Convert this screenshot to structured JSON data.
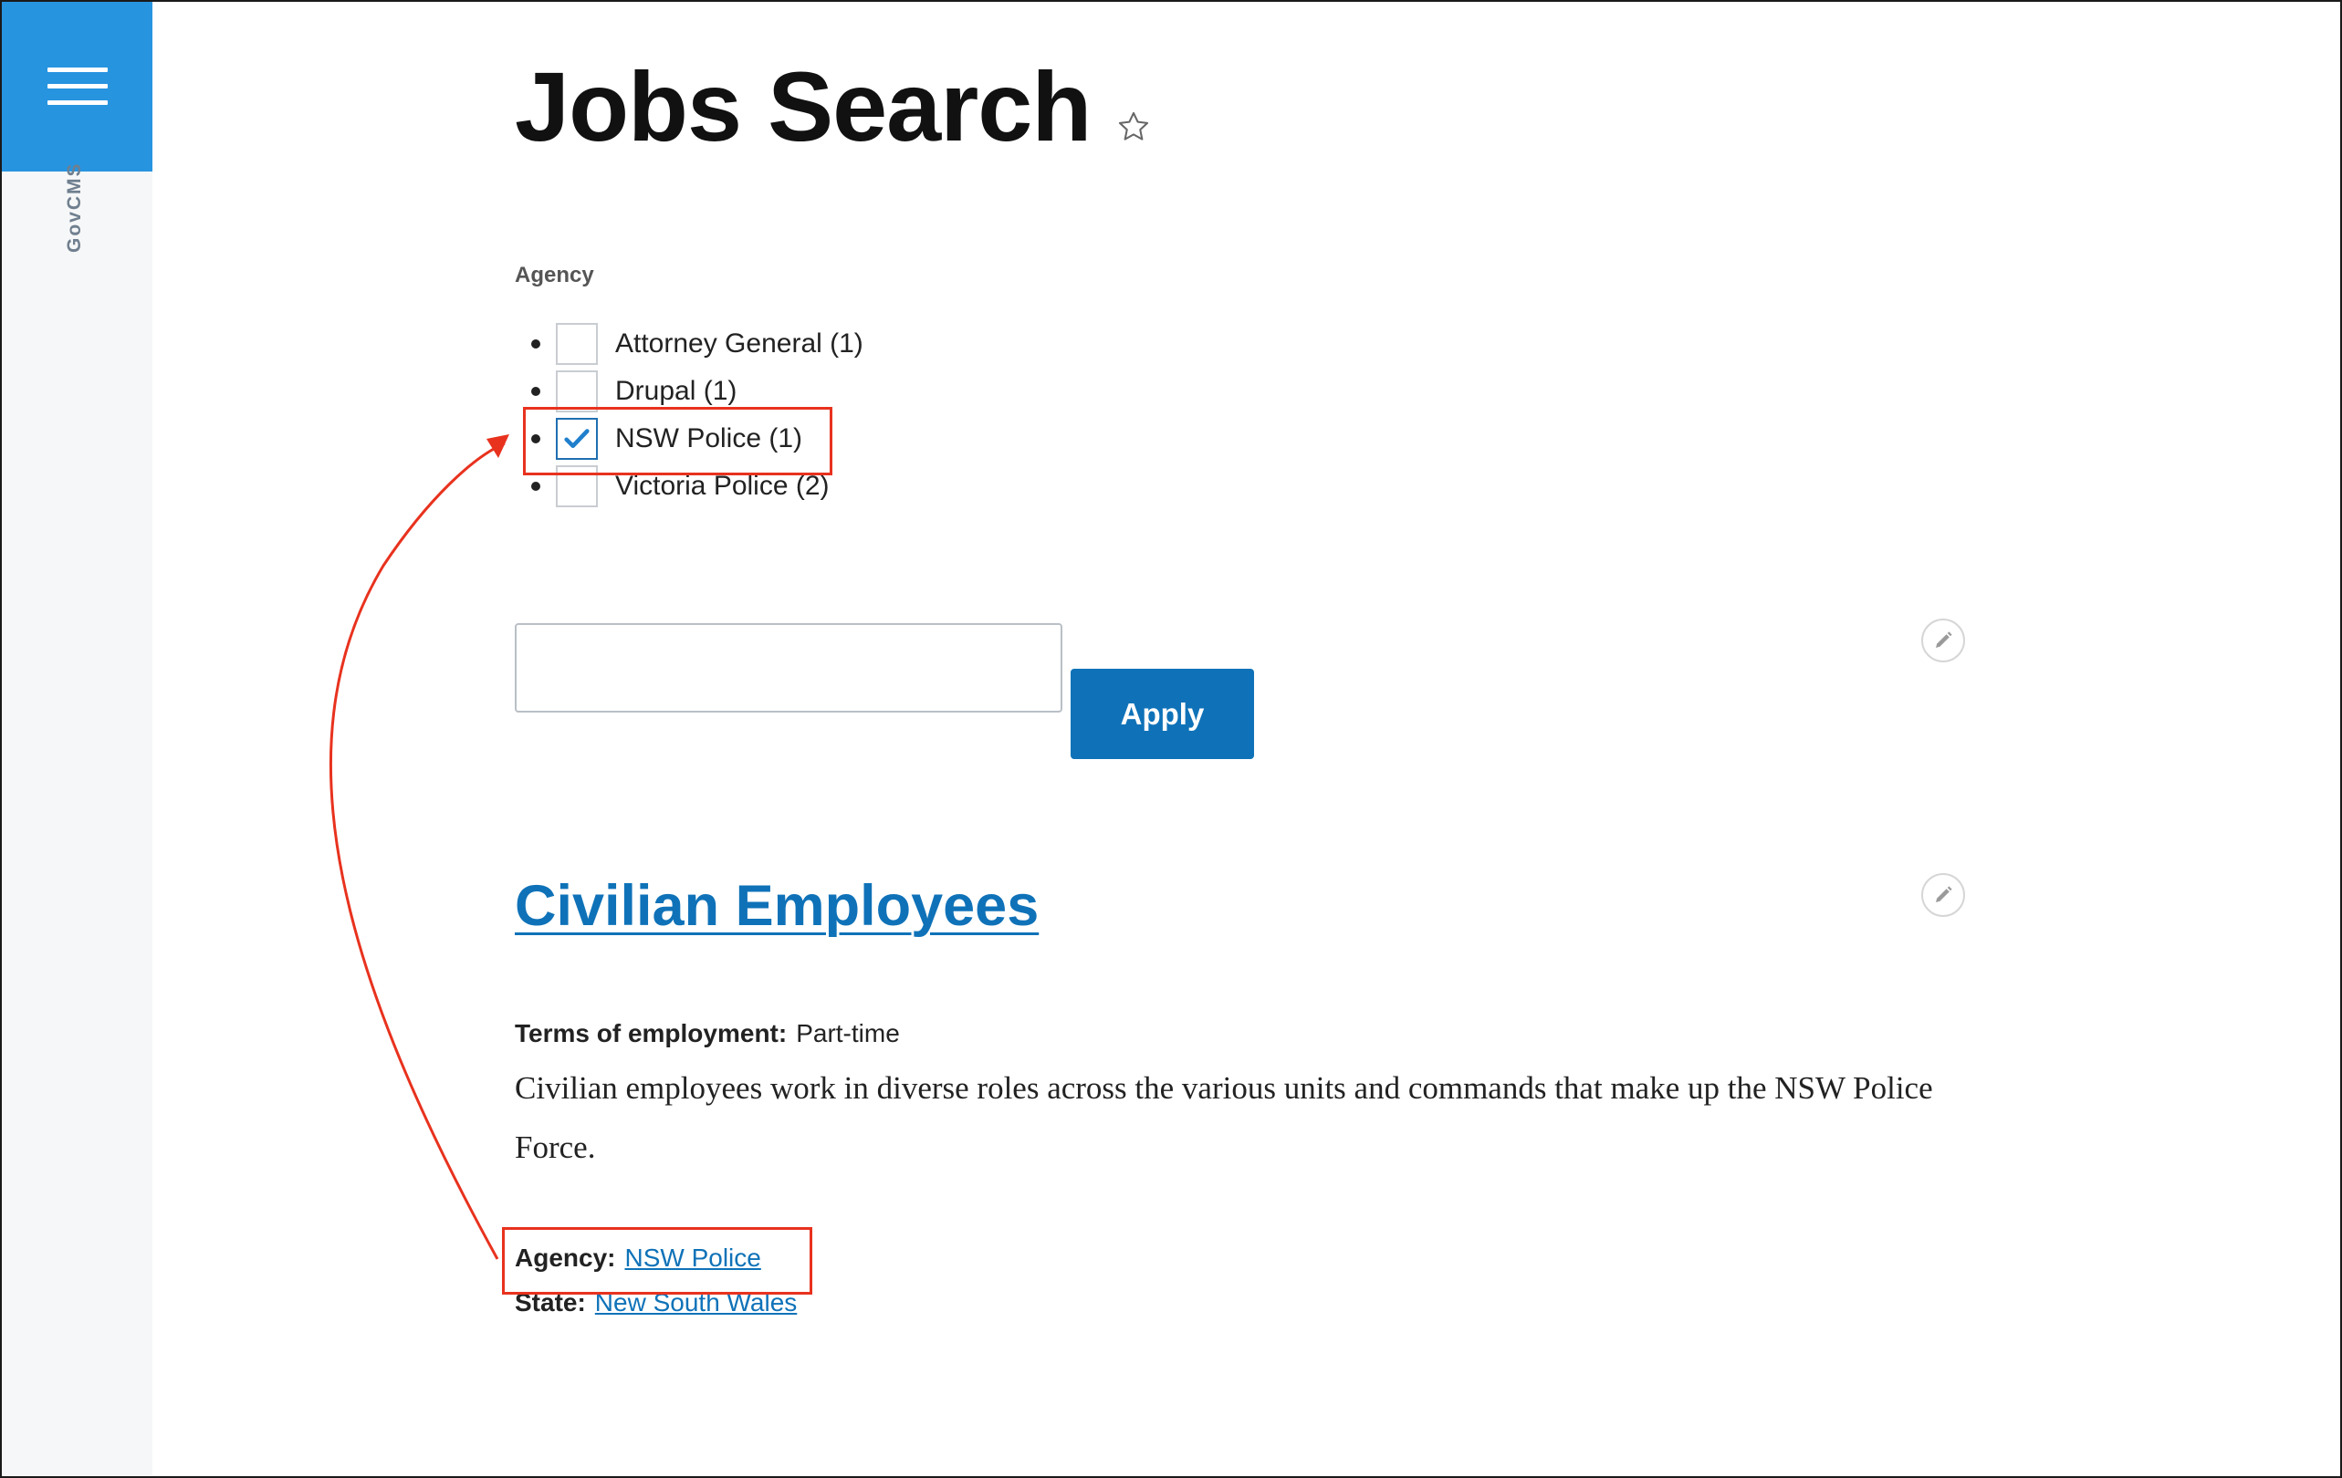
{
  "sidebar": {
    "brand": "GovCMS",
    "menu_icon": "hamburger-menu-icon"
  },
  "header": {
    "title": "Jobs Search",
    "favorite_icon": "star-outline-icon"
  },
  "facets": {
    "label": "Agency",
    "items": [
      {
        "label": "Attorney General (1)",
        "checked": false
      },
      {
        "label": "Drupal (1)",
        "checked": false
      },
      {
        "label": "NSW Police (1)",
        "checked": true
      },
      {
        "label": "Victoria Police (2)",
        "checked": false
      }
    ]
  },
  "search": {
    "value": "",
    "placeholder": "",
    "apply_label": "Apply"
  },
  "result": {
    "title": "Civilian Employees",
    "terms_label": "Terms of employment:",
    "terms_value": "Part-time",
    "body": "Civilian employees work in diverse roles across the various units and commands that make up the NSW Police Force.",
    "agency_label": "Agency:",
    "agency_value": "NSW Police",
    "state_label": "State:",
    "state_value": "New South Wales"
  },
  "colors": {
    "accent": "#0f72b8",
    "sidebar_button": "#2794e0",
    "annotation": "#e8321e"
  }
}
